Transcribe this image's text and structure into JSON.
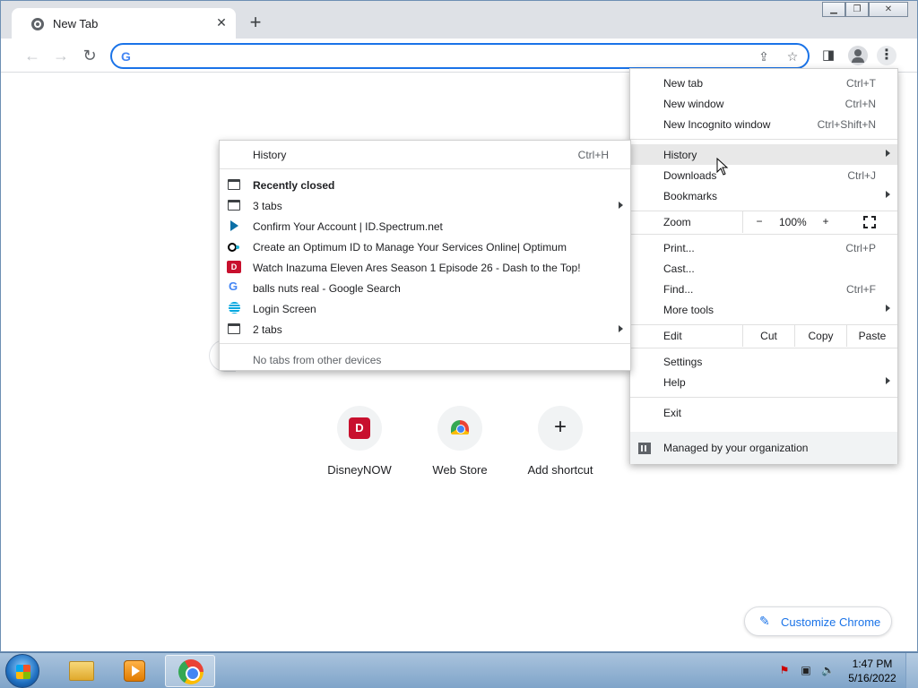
{
  "browser": {
    "tab_title": "New Tab",
    "tab_close": "✕",
    "new_tab_button": "+",
    "omnibox_value": "",
    "omnibox_logo": "G"
  },
  "ntp": {
    "shortcuts": [
      {
        "label": "DisneyNOW",
        "icon": "disney-icon"
      },
      {
        "label": "Web Store",
        "icon": "web-store-icon"
      },
      {
        "label": "Add shortcut",
        "icon": "plus-icon"
      }
    ],
    "customize_label": "Customize Chrome"
  },
  "menu": {
    "new_tab": {
      "label": "New tab",
      "shortcut": "Ctrl+T"
    },
    "new_window": {
      "label": "New window",
      "shortcut": "Ctrl+N"
    },
    "new_incognito": {
      "label": "New Incognito window",
      "shortcut": "Ctrl+Shift+N"
    },
    "history": {
      "label": "History"
    },
    "downloads": {
      "label": "Downloads",
      "shortcut": "Ctrl+J"
    },
    "bookmarks": {
      "label": "Bookmarks"
    },
    "zoom": {
      "label": "Zoom",
      "minus": "−",
      "value": "100%",
      "plus": "+"
    },
    "print": {
      "label": "Print...",
      "shortcut": "Ctrl+P"
    },
    "cast": {
      "label": "Cast..."
    },
    "find": {
      "label": "Find...",
      "shortcut": "Ctrl+F"
    },
    "more_tools": {
      "label": "More tools"
    },
    "edit": {
      "label": "Edit",
      "cut": "Cut",
      "copy": "Copy",
      "paste": "Paste"
    },
    "settings": {
      "label": "Settings"
    },
    "help": {
      "label": "Help"
    },
    "exit": {
      "label": "Exit"
    },
    "managed": {
      "label": "Managed by your organization"
    }
  },
  "history_submenu": {
    "history": {
      "label": "History",
      "shortcut": "Ctrl+H"
    },
    "recently_closed": "Recently closed",
    "items": [
      {
        "label": "3 tabs",
        "icon": "window-icon",
        "has_submenu": true
      },
      {
        "label": "Confirm Your Account | ID.Spectrum.net",
        "icon": "spectrum-icon",
        "has_submenu": false
      },
      {
        "label": "Create an Optimum ID to Manage Your Services Online| Optimum",
        "icon": "optimum-icon",
        "has_submenu": false
      },
      {
        "label": "Watch Inazuma Eleven Ares Season 1 Episode 26 - Dash to the Top!",
        "icon": "disney-icon",
        "has_submenu": false
      },
      {
        "label": "balls nuts real - Google Search",
        "icon": "google-icon",
        "has_submenu": false
      },
      {
        "label": "Login Screen",
        "icon": "att-icon",
        "has_submenu": false
      },
      {
        "label": "2 tabs",
        "icon": "window-icon",
        "has_submenu": true
      }
    ],
    "no_tabs": "No tabs from other devices"
  },
  "taskbar": {
    "time": "1:47 PM",
    "date": "5/16/2022"
  }
}
